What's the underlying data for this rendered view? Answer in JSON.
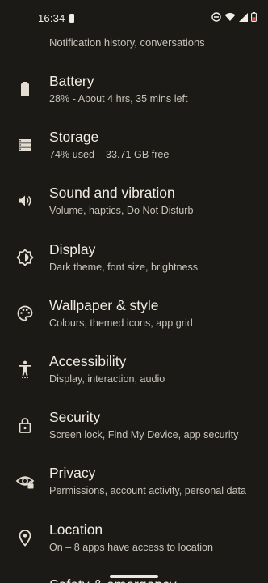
{
  "status_bar": {
    "time": "16:34",
    "icons": [
      "notification-icon",
      "do-not-disturb-icon",
      "wifi-icon",
      "signal-icon",
      "battery-low-icon"
    ]
  },
  "top_item": {
    "subtitle": "Notification history, conversations",
    "icon": "notifications-icon"
  },
  "items": [
    {
      "icon": "battery-icon",
      "title": "Battery",
      "subtitle": "28% - About 4 hrs, 35 mins left"
    },
    {
      "icon": "storage-icon",
      "title": "Storage",
      "subtitle": "74% used – 33.71 GB free"
    },
    {
      "icon": "sound-icon",
      "title": "Sound and vibration",
      "subtitle": "Volume, haptics, Do Not Disturb"
    },
    {
      "icon": "display-icon",
      "title": "Display",
      "subtitle": "Dark theme, font size, brightness"
    },
    {
      "icon": "palette-icon",
      "title": "Wallpaper & style",
      "subtitle": "Colours, themed icons, app grid"
    },
    {
      "icon": "accessibility-icon",
      "title": "Accessibility",
      "subtitle": "Display, interaction, audio"
    },
    {
      "icon": "lock-icon",
      "title": "Security",
      "subtitle": "Screen lock, Find My Device, app security"
    },
    {
      "icon": "privacy-eye-icon",
      "title": "Privacy",
      "subtitle": "Permissions, account activity, personal data"
    },
    {
      "icon": "location-pin-icon",
      "title": "Location",
      "subtitle": "On – 8 apps have access to location"
    }
  ],
  "bottom_partial": {
    "title": "Safety & emergency"
  },
  "colors": {
    "background": "#1b1a17",
    "title_text": "#f1ebe1",
    "subtitle_text": "#c9c3b8",
    "icon": "#e4ddd2",
    "battery_low": "#e0473b"
  }
}
